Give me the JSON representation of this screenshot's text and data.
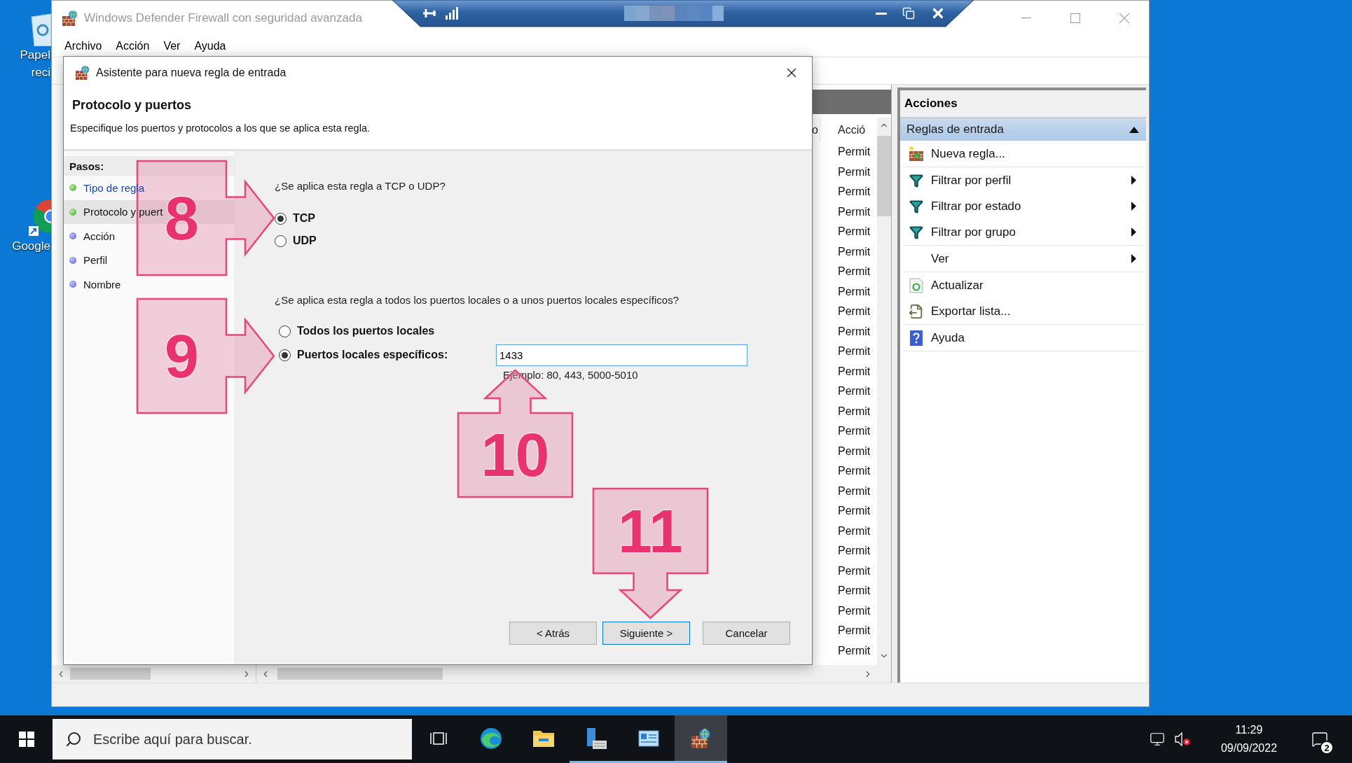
{
  "desktop": {
    "icons": [
      {
        "kind": "recycle-bin",
        "lines": [
          "Papel",
          "reci"
        ]
      },
      {
        "kind": "browser",
        "lines": [
          "Google"
        ]
      }
    ]
  },
  "main_window": {
    "title": "Windows Defender Firewall con seguridad avanzada",
    "active": false,
    "menu": [
      "Archivo",
      "Acción",
      "Ver",
      "Ayuda"
    ],
    "list": {
      "columns": [
        "o",
        "Acció"
      ],
      "rows": [
        "Permit",
        "Permit",
        "Permit",
        "Permit",
        "Permit",
        "Permit",
        "Permit",
        "Permit",
        "Permit",
        "Permit",
        "Permit",
        "Permit",
        "Permit",
        "Permit",
        "Permit",
        "Permit",
        "Permit",
        "Permit",
        "Permit",
        "Permit",
        "Permit",
        "Permit",
        "Permit",
        "Permit",
        "Permit",
        "Permit"
      ]
    },
    "actions": {
      "title": "Acciones",
      "section": {
        "label": "Reglas de entrada",
        "expanded": true
      },
      "groups": [
        [
          {
            "label": "Nueva regla...",
            "kind": "new",
            "submenu": false
          }
        ],
        [
          {
            "label": "Filtrar por perfil",
            "kind": "filter",
            "submenu": true
          },
          {
            "label": "Filtrar por estado",
            "kind": "filter",
            "submenu": true
          },
          {
            "label": "Filtrar por grupo",
            "kind": "filter",
            "submenu": true
          }
        ],
        [
          {
            "label": "Ver",
            "kind": "plain",
            "submenu": true
          }
        ],
        [
          {
            "label": "Actualizar",
            "kind": "refresh",
            "submenu": false
          },
          {
            "label": "Exportar lista...",
            "kind": "export",
            "submenu": false
          }
        ],
        [
          {
            "label": "Ayuda",
            "kind": "help",
            "submenu": false
          }
        ]
      ]
    }
  },
  "dialog": {
    "title": "Asistente para nueva regla de entrada",
    "heading": "Protocolo y puertos",
    "description": "Especifique los puertos y protocolos a los que se aplica esta regla.",
    "steps_title": "Pasos:",
    "steps": [
      {
        "label": "Tipo de regla",
        "done": true,
        "selected": false
      },
      {
        "label": "Protocolo y puert",
        "done": true,
        "selected": true
      },
      {
        "label": "Acción",
        "done": false,
        "selected": false
      },
      {
        "label": "Perfil",
        "done": false,
        "selected": false
      },
      {
        "label": "Nombre",
        "done": false,
        "selected": false
      }
    ],
    "protocol": {
      "question": "¿Se aplica esta regla a TCP o UDP?",
      "options": [
        {
          "label": "TCP",
          "selected": true
        },
        {
          "label": "UDP",
          "selected": false
        }
      ]
    },
    "ports": {
      "question": "¿Se aplica esta regla a todos los puertos locales o a unos puertos locales específicos?",
      "options": [
        {
          "label": "Todos los puertos locales",
          "selected": false
        },
        {
          "label": "Puertos locales específicos:",
          "selected": true
        }
      ],
      "value": "1433",
      "example": "Ejemplo: 80, 443, 5000-5010"
    },
    "buttons": [
      {
        "label": "< Atrás",
        "focused": false
      },
      {
        "label": "Siguiente >",
        "focused": true
      },
      {
        "label": "Cancelar",
        "focused": false
      }
    ]
  },
  "callouts": [
    {
      "number": "8",
      "kind": "right"
    },
    {
      "number": "9",
      "kind": "right"
    },
    {
      "number": "10",
      "kind": "up"
    },
    {
      "number": "11",
      "kind": "down"
    }
  ],
  "taskbar": {
    "search_placeholder": "Escribe aquí para buscar.",
    "apps": [
      {
        "kind": "taskview",
        "running": false,
        "active": false
      },
      {
        "kind": "browser",
        "running": false,
        "active": false
      },
      {
        "kind": "files",
        "running": false,
        "active": false
      },
      {
        "kind": "server",
        "running": true,
        "active": false
      },
      {
        "kind": "window",
        "running": true,
        "active": false
      },
      {
        "kind": "firewall",
        "running": true,
        "active": true
      }
    ],
    "volume_muted": true,
    "time": "11:29",
    "date": "09/09/2022",
    "notifications": "2"
  }
}
